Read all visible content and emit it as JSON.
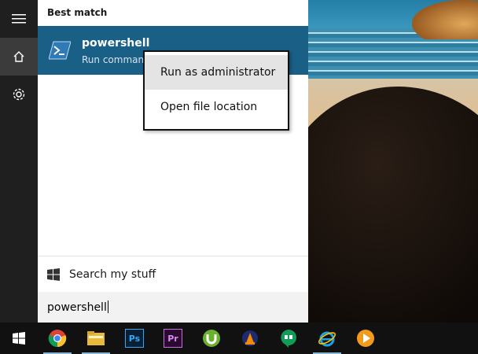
{
  "rail": {
    "items": [
      {
        "name": "hamburger-icon"
      },
      {
        "name": "home-icon"
      },
      {
        "name": "gear-icon"
      }
    ]
  },
  "panel": {
    "section_title": "Best match",
    "result": {
      "title": "powershell",
      "subtitle": "Run command",
      "icon": "powershell-icon"
    },
    "search_my_stuff": "Search my stuff",
    "search_query": "powershell"
  },
  "context_menu": {
    "items": [
      {
        "label": "Run as administrator",
        "highlighted": true
      },
      {
        "label": "Open file location",
        "highlighted": false
      }
    ]
  },
  "taskbar": {
    "apps": [
      "start-icon",
      "chrome-icon",
      "file-explorer-icon",
      "photoshop-icon",
      "premiere-icon",
      "utorrent-icon",
      "vlc-icon",
      "hangouts-icon",
      "internet-explorer-icon",
      "media-player-icon"
    ],
    "photoshop_label": "Ps",
    "premiere_label": "Pr"
  },
  "colors": {
    "accent": "#1a5f86",
    "rail": "#1f1f1f",
    "taskbar": "#111111"
  }
}
